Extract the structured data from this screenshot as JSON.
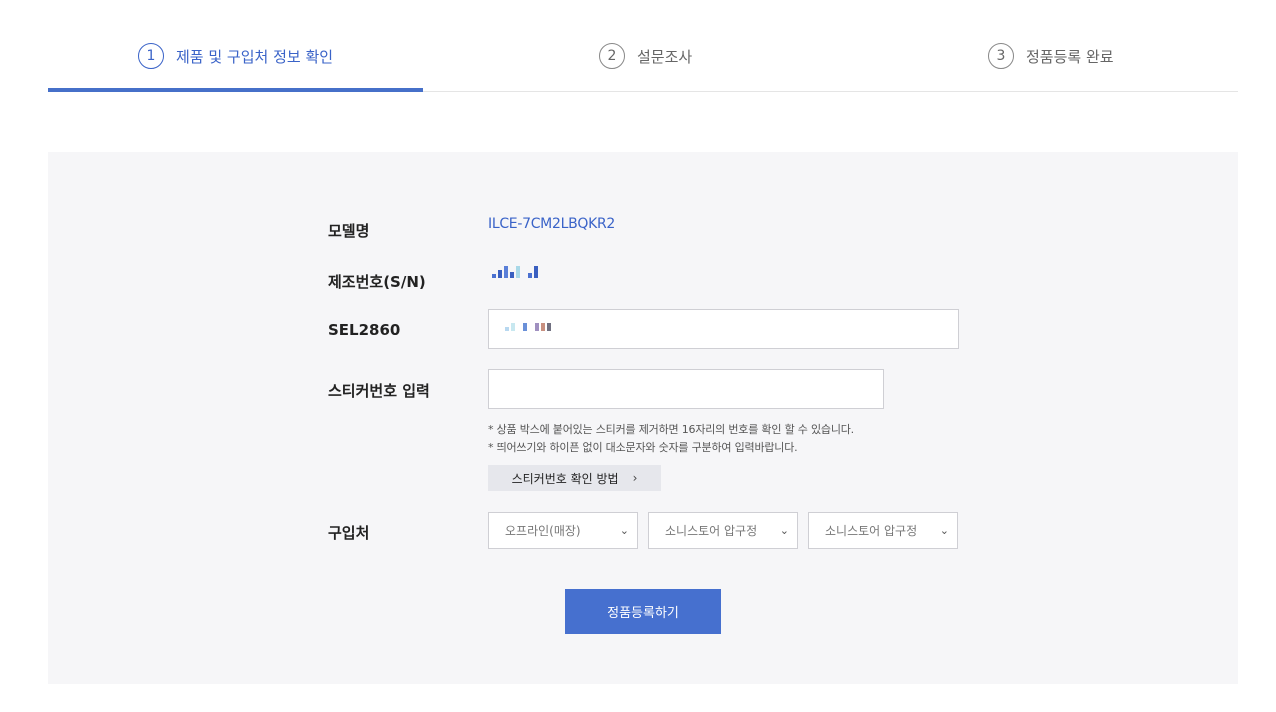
{
  "steps": [
    {
      "number": "1",
      "label": "제품 및 구입처 정보 확인",
      "active": true
    },
    {
      "number": "2",
      "label": "설문조사",
      "active": false
    },
    {
      "number": "3",
      "label": "정품등록 완료",
      "active": false
    }
  ],
  "form": {
    "model_label": "모델명",
    "model_value": "ILCE-7CM2LBQKR2",
    "serial_label": "제조번호(S/N)",
    "sel_label": "SEL2860",
    "sticker_label": "스티커번호 입력",
    "sticker_value": "",
    "hint_1": "* 상품 박스에 붙어있는 스티커를 제거하면 16자리의 번호를 확인 할 수 있습니다.",
    "hint_2": "* 띄어쓰기와 하이픈 없이 대소문자와 숫자를 구분하여 입력바랍니다.",
    "howto_button": "스티커번호 확인 방법",
    "purchase_label": "구입처",
    "purchase_selects": [
      "오프라인(매장)",
      "소니스토어 압구정",
      "소니스토어 압구정"
    ],
    "submit_button": "정품등록하기"
  },
  "colors": {
    "accent": "#3a63c8",
    "button": "#4670cf",
    "panel_bg": "#f6f6f8"
  },
  "icons": {
    "chevron_right": "chevron-right-icon",
    "chevron_down": "chevron-down-icon"
  }
}
